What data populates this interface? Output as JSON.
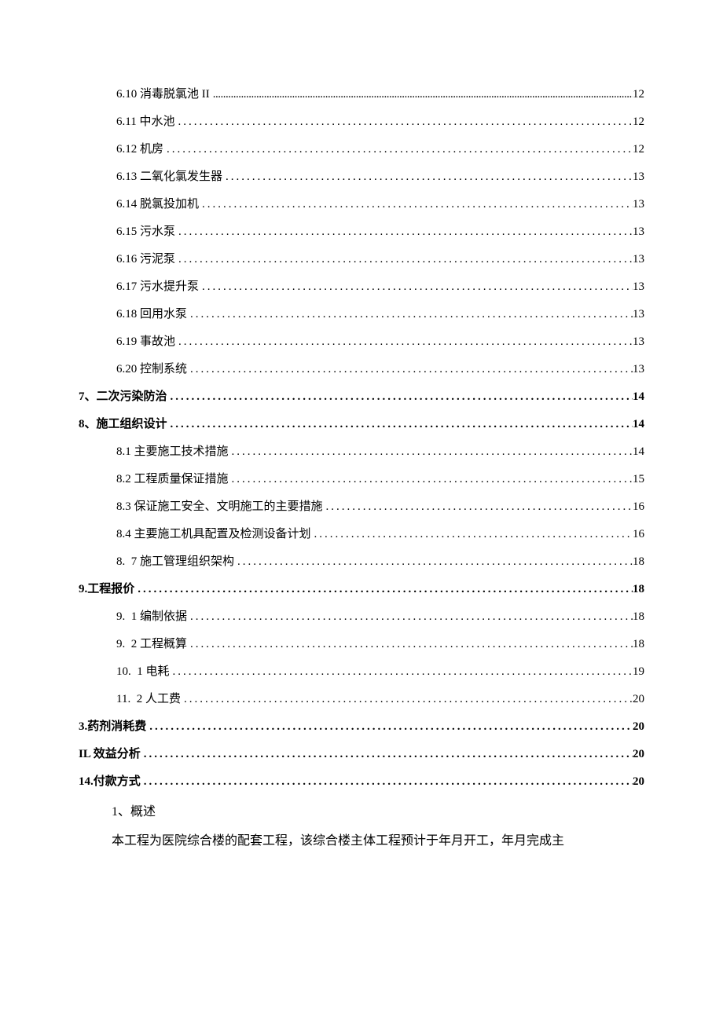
{
  "toc": [
    {
      "level": 1,
      "label": "6.10 消毒脱氯池 II",
      "page": "12",
      "compact": true,
      "bold_page": false
    },
    {
      "level": 1,
      "label": "6.11 中水池",
      "page": "12",
      "compact": false,
      "bold_page": false
    },
    {
      "level": 1,
      "label": "6.12 机房",
      "page": "12",
      "compact": false,
      "bold_page": false
    },
    {
      "level": 1,
      "label": "6.13 二氧化氯发生器",
      "page": "13",
      "compact": false,
      "bold_page": false
    },
    {
      "level": 1,
      "label": "6.14 脱氯投加机",
      "page": "13",
      "compact": false,
      "bold_page": false
    },
    {
      "level": 1,
      "label": "6.15 污水泵",
      "page": "13",
      "compact": false,
      "bold_page": false
    },
    {
      "level": 1,
      "label": "6.16 污泥泵",
      "page": "13",
      "compact": false,
      "bold_page": false
    },
    {
      "level": 1,
      "label": "6.17 污水提升泵",
      "page": "13",
      "compact": false,
      "bold_page": false
    },
    {
      "level": 1,
      "label": "6.18 回用水泵",
      "page": "13",
      "compact": false,
      "bold_page": false
    },
    {
      "level": 1,
      "label": "6.19 事故池",
      "page": "13",
      "compact": false,
      "bold_page": false
    },
    {
      "level": 1,
      "label": "6.20 控制系统",
      "page": "13",
      "compact": false,
      "bold_page": false
    },
    {
      "level": 0,
      "label": "7、二次污染防治",
      "page": "14",
      "compact": false,
      "bold_page": true
    },
    {
      "level": 0,
      "label": "8、施工组织设计",
      "page": "14",
      "compact": false,
      "bold_page": true
    },
    {
      "level": 1,
      "label": "8.1 主要施工技术措施",
      "page": "14",
      "compact": false,
      "bold_page": false
    },
    {
      "level": 1,
      "label": "8.2 工程质量保证措施",
      "page": "15",
      "compact": false,
      "bold_page": false
    },
    {
      "level": 1,
      "label": "8.3 保证施工安全、文明施工的主要措施",
      "page": "16",
      "compact": false,
      "bold_page": false
    },
    {
      "level": 1,
      "label": "8.4 主要施工机具配置及检测设备计划",
      "page": "16",
      "compact": false,
      "bold_page": false
    },
    {
      "level": 1,
      "label": "8.  7 施工管理组织架构",
      "page": "18",
      "compact": false,
      "bold_page": false
    },
    {
      "level": 0,
      "label": "9.工程报价",
      "page": "18",
      "compact": false,
      "bold_page": true
    },
    {
      "level": 1,
      "label": "9.  1 编制依据",
      "page": "18",
      "compact": false,
      "bold_page": false
    },
    {
      "level": 1,
      "label": "9.  2 工程概算",
      "page": "18",
      "compact": false,
      "bold_page": false
    },
    {
      "level": 1,
      "label": "10.  1 电耗",
      "page": "19",
      "compact": false,
      "bold_page": false
    },
    {
      "level": 1,
      "label": "11.  2 人工费",
      "page": "20",
      "compact": false,
      "bold_page": false
    },
    {
      "level": 0,
      "label": "3.药剂消耗费",
      "page": "20",
      "compact": false,
      "bold_page": true
    },
    {
      "level": 0,
      "label": "IL 效益分析",
      "page": "20",
      "compact": false,
      "bold_page": true
    },
    {
      "level": 0,
      "label": "14.付款方式",
      "page": "20",
      "compact": false,
      "bold_page": true
    }
  ],
  "body": {
    "heading": "1、概述",
    "paragraph": "本工程为医院综合楼的配套工程，该综合楼主体工程预计于年月开工，年月完成主"
  }
}
